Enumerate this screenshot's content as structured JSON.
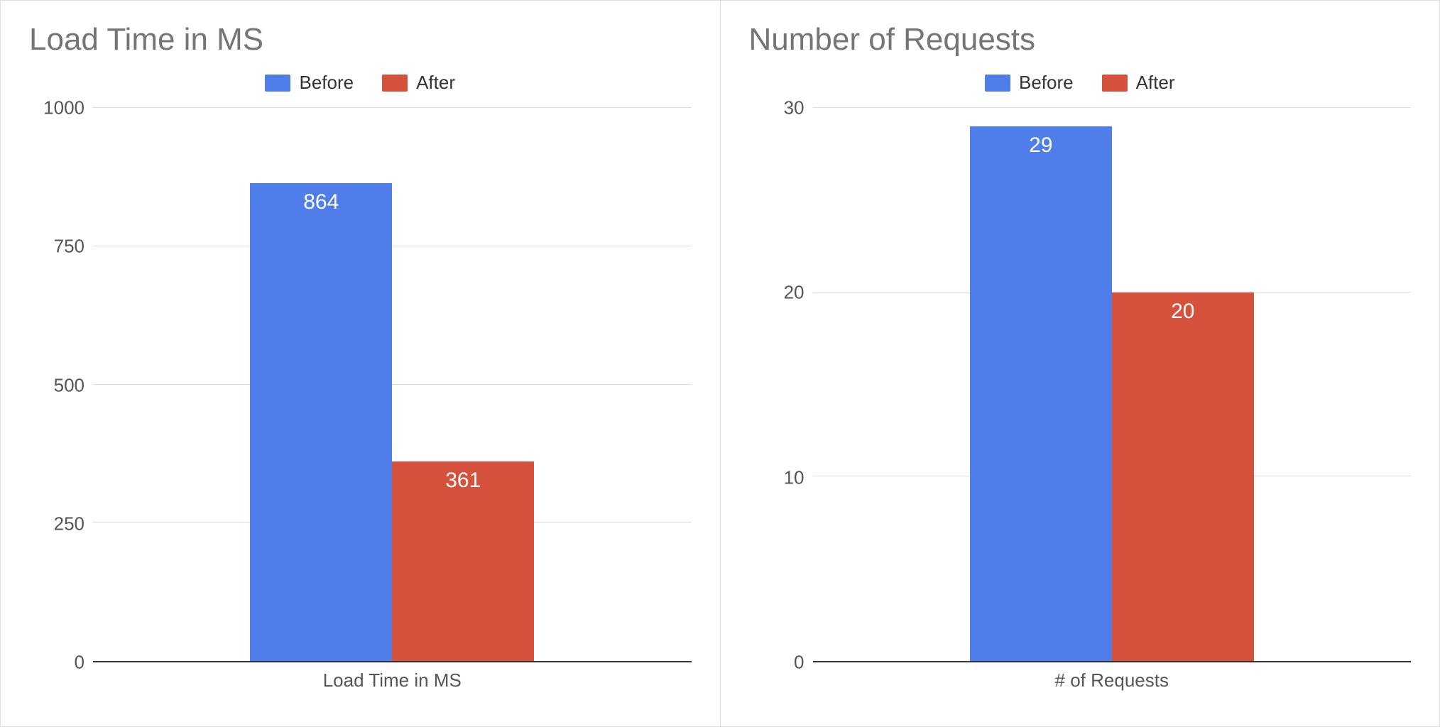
{
  "chart_data": [
    {
      "type": "bar",
      "title": "Load Time in MS",
      "categories": [
        "Load Time in MS"
      ],
      "series": [
        {
          "name": "Before",
          "values": [
            864
          ],
          "color": "#4f7de9"
        },
        {
          "name": "After",
          "values": [
            361
          ],
          "color": "#d6513c"
        }
      ],
      "xlabel": "Load Time in MS",
      "ylabel": "",
      "ylim": [
        0,
        1000
      ],
      "yticks": [
        0,
        250,
        500,
        750,
        1000
      ]
    },
    {
      "type": "bar",
      "title": "Number of Requests",
      "categories": [
        "# of Requests"
      ],
      "series": [
        {
          "name": "Before",
          "values": [
            29
          ],
          "color": "#4f7de9"
        },
        {
          "name": "After",
          "values": [
            20
          ],
          "color": "#d6513c"
        }
      ],
      "xlabel": "# of Requests",
      "ylabel": "",
      "ylim": [
        0,
        30
      ],
      "yticks": [
        0,
        10,
        20,
        30
      ]
    }
  ],
  "charts": [
    {
      "title": "Load Time in MS",
      "legend": {
        "before": "Before",
        "after": "After"
      },
      "colors": {
        "before": "#4f7de9",
        "after": "#d6513c"
      },
      "yticks": [
        "0",
        "250",
        "500",
        "750",
        "1000"
      ],
      "ymax": 1000,
      "bars": {
        "before": 864,
        "after": 361
      },
      "bar_labels": {
        "before": "864",
        "after": "361"
      },
      "xlabel": "Load Time in MS"
    },
    {
      "title": "Number of Requests",
      "legend": {
        "before": "Before",
        "after": "After"
      },
      "colors": {
        "before": "#4f7de9",
        "after": "#d6513c"
      },
      "yticks": [
        "0",
        "10",
        "20",
        "30"
      ],
      "ymax": 30,
      "bars": {
        "before": 29,
        "after": 20
      },
      "bar_labels": {
        "before": "29",
        "after": "20"
      },
      "xlabel": "# of Requests"
    }
  ]
}
